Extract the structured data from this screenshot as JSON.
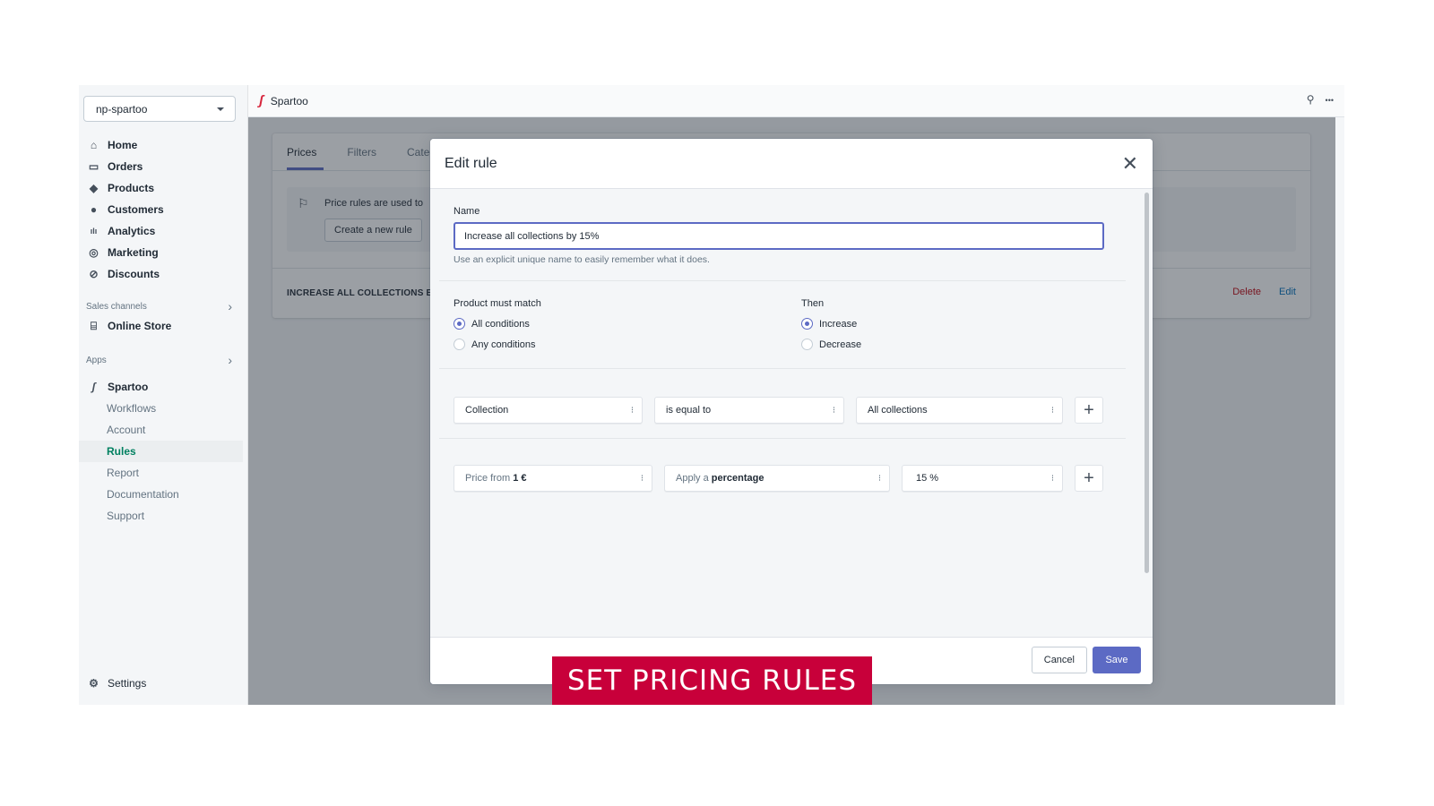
{
  "sidebar": {
    "store_name": "np-spartoo",
    "nav": [
      {
        "label": "Home",
        "icon": "home-icon",
        "glyph": "⌂"
      },
      {
        "label": "Orders",
        "icon": "orders-icon",
        "glyph": "▭"
      },
      {
        "label": "Products",
        "icon": "tag-icon",
        "glyph": "◆"
      },
      {
        "label": "Customers",
        "icon": "person-icon",
        "glyph": "●"
      },
      {
        "label": "Analytics",
        "icon": "bar-chart-icon",
        "glyph": "ılı"
      },
      {
        "label": "Marketing",
        "icon": "target-icon",
        "glyph": "◎"
      },
      {
        "label": "Discounts",
        "icon": "discount-icon",
        "glyph": "⊘"
      }
    ],
    "sales_channels_label": "Sales channels",
    "online_store_label": "Online Store",
    "apps_label": "Apps",
    "app_name": "Spartoo",
    "app_items": [
      "Workflows",
      "Account",
      "Rules",
      "Report",
      "Documentation",
      "Support"
    ],
    "active_app_item": "Rules",
    "settings_label": "Settings"
  },
  "topbar": {
    "app_title": "Spartoo",
    "pin_glyph": "⚲",
    "more_glyph": "•••"
  },
  "page": {
    "tabs": [
      "Prices",
      "Filters",
      "Categ"
    ],
    "active_tab": "Prices",
    "banner_text": "Price rules are used to",
    "create_button": "Create a new rule",
    "rule_name": "INCREASE ALL COLLECTIONS BY",
    "delete_label": "Delete",
    "edit_label": "Edit"
  },
  "modal": {
    "title": "Edit rule",
    "close_glyph": "✕",
    "name_label": "Name",
    "name_value": "Increase all collections by 15%",
    "help_text": "Use an explicit unique name to easily remember what it does.",
    "match_label": "Product must match",
    "match_options": [
      {
        "label": "All conditions",
        "selected": true
      },
      {
        "label": "Any conditions",
        "selected": false
      }
    ],
    "then_label": "Then",
    "then_options": [
      {
        "label": "Increase",
        "selected": true
      },
      {
        "label": "Decrease",
        "selected": false
      }
    ],
    "condition": {
      "field": "Collection",
      "operator": "is equal to",
      "value": "All collections"
    },
    "action": {
      "price_prefix": "Price from ",
      "price_value": "1 €",
      "apply_prefix": "Apply a ",
      "apply_value": "percentage",
      "amount": "15 %"
    },
    "cancel_label": "Cancel",
    "save_label": "Save"
  },
  "caption": "SET PRICING RULES",
  "colors": {
    "accent": "#5c6ac4",
    "active_nav": "#008060",
    "caption_bg": "#c8003a",
    "delete": "#bf0711",
    "edit": "#006fbb"
  }
}
